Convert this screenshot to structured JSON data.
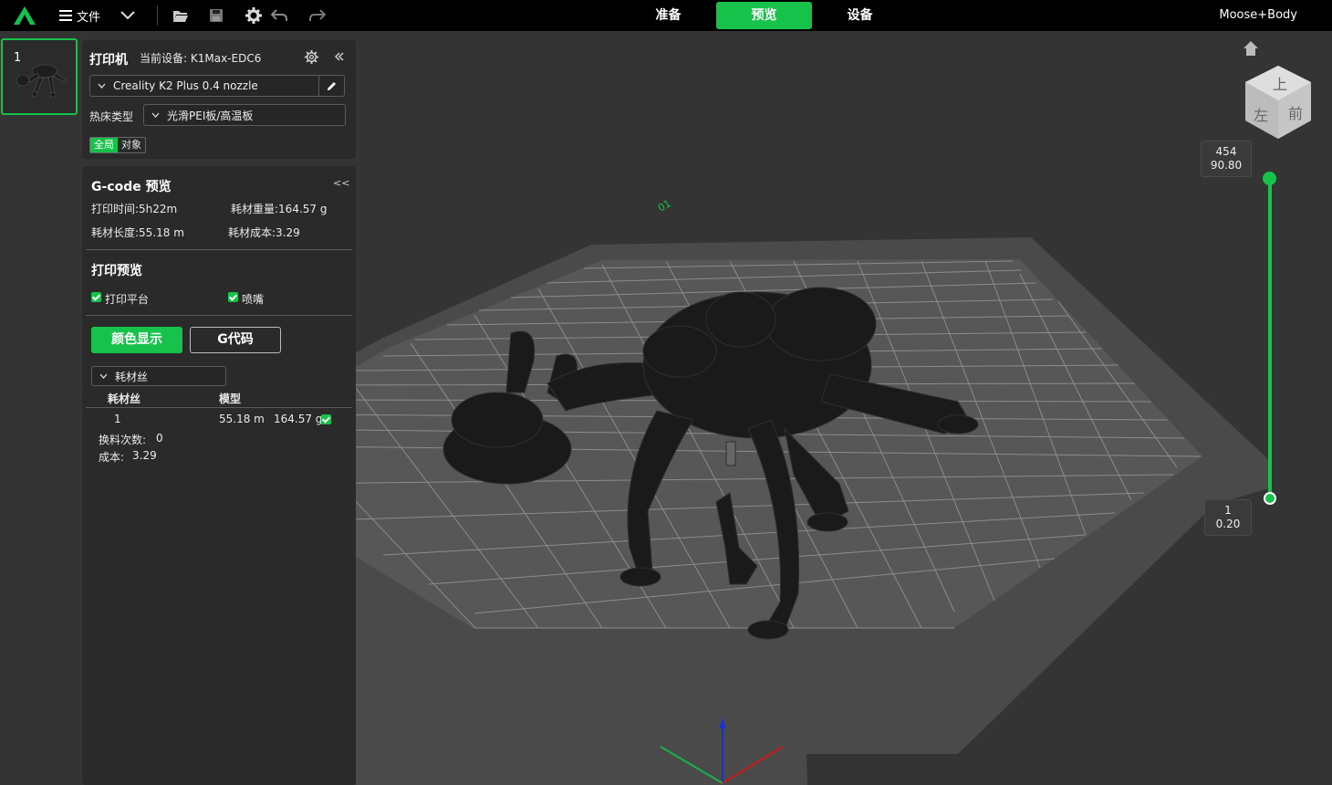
{
  "topbar": {
    "menu_label": "文件",
    "tabs": [
      {
        "label": "准备",
        "active": false
      },
      {
        "label": "预览",
        "active": true
      },
      {
        "label": "设备",
        "active": false
      }
    ],
    "project_title": "Moose+Body",
    "accent_color": "#17c24b"
  },
  "plate": {
    "number": "1"
  },
  "printer_panel": {
    "title": "打印机",
    "current_device": "当前设备: K1Max-EDC6",
    "printer_preset": "Creality K2 Plus 0.4 nozzle",
    "bed_type_label": "热床类型",
    "bed_type_value": "光滑PEI板/高温板",
    "scope_global": "全局",
    "scope_object": "对象"
  },
  "gcode_panel": {
    "title": "G-code 预览",
    "collapse": "<<",
    "print_time": "打印时间:5h22m",
    "filament_weight": "耗材重量:164.57 g",
    "filament_length": "耗材长度:55.18 m",
    "filament_cost": "耗材成本:3.29",
    "preview_title": "打印预览",
    "show_bed": "打印平台",
    "show_nozzle": "喷嘴",
    "color_display_button": "颜色显示",
    "gcode_button": "G代码",
    "view_mode": "耗材丝",
    "table_headers": [
      "耗材丝",
      "模型"
    ],
    "table_row": {
      "filament": "1",
      "length": "55.18 m",
      "weight": "164.57 g"
    },
    "changes_label": "换料次数:",
    "changes_value": "0",
    "cost_label": "成本:",
    "cost_value": "3.29"
  },
  "layer_slider": {
    "top_layer": "454",
    "top_height": "90.80",
    "bottom_layer": "1",
    "bottom_height": "0.20"
  },
  "viewcube": {
    "top": "上",
    "left": "左",
    "front": "前"
  },
  "bed_label": "01"
}
